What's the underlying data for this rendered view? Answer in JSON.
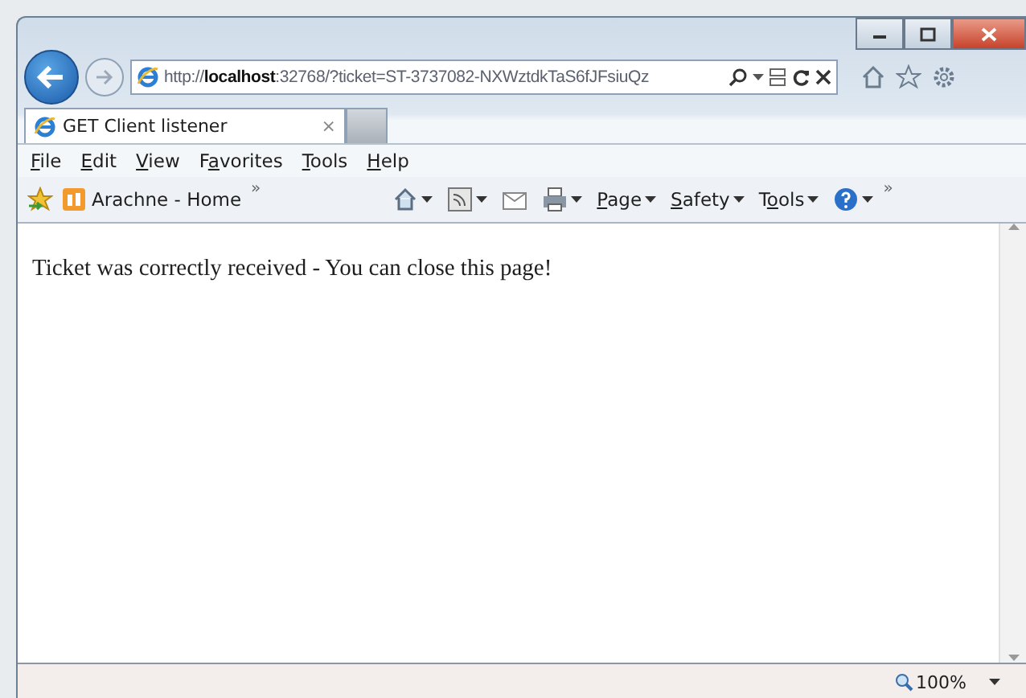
{
  "address_bar": {
    "url_prefix": "http://",
    "url_host": "localhost",
    "url_rest": ":32768/?ticket=ST-3737082-NXWztdkTaS6fJFsiuQz"
  },
  "tabs": [
    {
      "label": "GET Client listener",
      "selected": true,
      "close": "×"
    }
  ],
  "menu_bar": [
    {
      "access_key": "F",
      "label_end": "ile"
    },
    {
      "access_key": "E",
      "label_end": "dit"
    },
    {
      "access_key": "V",
      "label_end": "iew"
    },
    {
      "label_start": "F",
      "access_key": "a",
      "label_end": "vorites"
    },
    {
      "access_key": "T",
      "label_end": "ools"
    },
    {
      "access_key": "H",
      "label_end": "elp"
    }
  ],
  "favorites_bar": {
    "items": [
      {
        "label": "Arachne - Home"
      }
    ],
    "overflow": "»"
  },
  "command_bar": [
    {
      "kind": "home"
    },
    {
      "kind": "feeds"
    },
    {
      "kind": "mail"
    },
    {
      "kind": "print"
    },
    {
      "kind": "text",
      "access_key": "P",
      "label_end": "age"
    },
    {
      "kind": "text",
      "access_key": "S",
      "label_end": "afety"
    },
    {
      "kind": "text",
      "label_start": "T",
      "access_key": "o",
      "label_end": "ols"
    },
    {
      "kind": "help"
    }
  ],
  "command_overflow": "»",
  "page": {
    "message": "Ticket was correctly received - You can close this page!"
  },
  "status_bar": {
    "zoom": "100%"
  }
}
